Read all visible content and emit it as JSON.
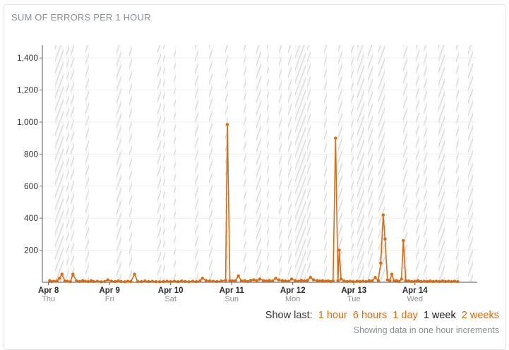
{
  "widget": {
    "title": "SUM OF ERRORS PER 1 HOUR"
  },
  "controls": {
    "show_last_label": "Show last:",
    "options": [
      {
        "label": "1 hour",
        "active": false
      },
      {
        "label": "6 hours",
        "active": false
      },
      {
        "label": "1 day",
        "active": false
      },
      {
        "label": "1 week",
        "active": true
      },
      {
        "label": "2 weeks",
        "active": false
      }
    ],
    "note": "Showing data in one hour increments"
  },
  "colors": {
    "series": "#d96b13",
    "accent": "#d96b13",
    "axis": "#555555"
  },
  "chart_data": {
    "type": "line",
    "title": "SUM OF ERRORS PER 1 HOUR",
    "xlabel": "",
    "ylabel": "",
    "ylim": [
      0,
      1480
    ],
    "y_ticks": [
      "200",
      "400",
      "600",
      "800",
      "1,000",
      "1,200",
      "1,400"
    ],
    "y_tick_values": [
      200,
      400,
      600,
      800,
      1000,
      1200,
      1400
    ],
    "x_ticks": [
      {
        "date": "Apr 8",
        "day": "Thu"
      },
      {
        "date": "Apr 9",
        "day": "Fri"
      },
      {
        "date": "Apr 10",
        "day": "Sat"
      },
      {
        "date": "Apr 11",
        "day": "Sun"
      },
      {
        "date": "Apr 12",
        "day": "Mon"
      },
      {
        "date": "Apr 13",
        "day": "Tue"
      },
      {
        "date": "Apr 14",
        "day": "Wed"
      }
    ],
    "x_range_days": [
      -0.1,
      7.02
    ],
    "grid": "vertical hatched bands",
    "legend": "none",
    "series": [
      {
        "points": [
          [
            0.02,
            10
          ],
          [
            0.05,
            5
          ],
          [
            0.09,
            6
          ],
          [
            0.14,
            8
          ],
          [
            0.18,
            25
          ],
          [
            0.22,
            50
          ],
          [
            0.27,
            8
          ],
          [
            0.31,
            6
          ],
          [
            0.36,
            4
          ],
          [
            0.4,
            50
          ],
          [
            0.46,
            8
          ],
          [
            0.51,
            5
          ],
          [
            0.56,
            10
          ],
          [
            0.6,
            6
          ],
          [
            0.65,
            5
          ],
          [
            0.7,
            10
          ],
          [
            0.74,
            5
          ],
          [
            0.8,
            6
          ],
          [
            0.86,
            3
          ],
          [
            0.92,
            5
          ],
          [
            0.97,
            15
          ],
          [
            1.03,
            6
          ],
          [
            1.09,
            5
          ],
          [
            1.14,
            8
          ],
          [
            1.19,
            5
          ],
          [
            1.25,
            3
          ],
          [
            1.3,
            6
          ],
          [
            1.35,
            5
          ],
          [
            1.41,
            50
          ],
          [
            1.46,
            5
          ],
          [
            1.52,
            4
          ],
          [
            1.58,
            8
          ],
          [
            1.64,
            5
          ],
          [
            1.7,
            6
          ],
          [
            1.76,
            4
          ],
          [
            1.82,
            3
          ],
          [
            1.88,
            5
          ],
          [
            1.94,
            6
          ],
          [
            2.0,
            5
          ],
          [
            2.06,
            6
          ],
          [
            2.12,
            4
          ],
          [
            2.18,
            8
          ],
          [
            2.24,
            5
          ],
          [
            2.3,
            3
          ],
          [
            2.36,
            6
          ],
          [
            2.42,
            4
          ],
          [
            2.48,
            8
          ],
          [
            2.52,
            25
          ],
          [
            2.58,
            10
          ],
          [
            2.64,
            8
          ],
          [
            2.7,
            6
          ],
          [
            2.76,
            5
          ],
          [
            2.83,
            8
          ],
          [
            2.9,
            12
          ],
          [
            2.93,
            985
          ],
          [
            2.97,
            10
          ],
          [
            3.01,
            8
          ],
          [
            3.06,
            10
          ],
          [
            3.11,
            40
          ],
          [
            3.16,
            8
          ],
          [
            3.21,
            10
          ],
          [
            3.26,
            5
          ],
          [
            3.31,
            12
          ],
          [
            3.36,
            15
          ],
          [
            3.41,
            10
          ],
          [
            3.46,
            20
          ],
          [
            3.52,
            10
          ],
          [
            3.57,
            8
          ],
          [
            3.62,
            10
          ],
          [
            3.67,
            8
          ],
          [
            3.72,
            25
          ],
          [
            3.77,
            15
          ],
          [
            3.83,
            10
          ],
          [
            3.88,
            8
          ],
          [
            3.93,
            6
          ],
          [
            3.98,
            20
          ],
          [
            4.04,
            10
          ],
          [
            4.09,
            6
          ],
          [
            4.14,
            12
          ],
          [
            4.19,
            8
          ],
          [
            4.24,
            12
          ],
          [
            4.29,
            30
          ],
          [
            4.34,
            15
          ],
          [
            4.4,
            10
          ],
          [
            4.44,
            8
          ],
          [
            4.49,
            10
          ],
          [
            4.54,
            6
          ],
          [
            4.58,
            8
          ],
          [
            4.62,
            5
          ],
          [
            4.66,
            8
          ],
          [
            4.7,
            900
          ],
          [
            4.74,
            10
          ],
          [
            4.76,
            200
          ],
          [
            4.79,
            20
          ],
          [
            4.84,
            8
          ],
          [
            4.89,
            5
          ],
          [
            4.94,
            6
          ],
          [
            4.99,
            5
          ],
          [
            5.05,
            6
          ],
          [
            5.1,
            5
          ],
          [
            5.15,
            6
          ],
          [
            5.2,
            5
          ],
          [
            5.25,
            10
          ],
          [
            5.3,
            8
          ],
          [
            5.35,
            30
          ],
          [
            5.4,
            10
          ],
          [
            5.44,
            120
          ],
          [
            5.48,
            420
          ],
          [
            5.51,
            270
          ],
          [
            5.55,
            15
          ],
          [
            5.59,
            10
          ],
          [
            5.62,
            50
          ],
          [
            5.66,
            8
          ],
          [
            5.7,
            10
          ],
          [
            5.74,
            5
          ],
          [
            5.78,
            20
          ],
          [
            5.81,
            260
          ],
          [
            5.85,
            10
          ],
          [
            5.9,
            8
          ],
          [
            5.95,
            5
          ],
          [
            6.0,
            6
          ],
          [
            6.05,
            10
          ],
          [
            6.1,
            5
          ],
          [
            6.15,
            6
          ],
          [
            6.2,
            5
          ],
          [
            6.25,
            8
          ],
          [
            6.3,
            5
          ],
          [
            6.35,
            6
          ],
          [
            6.4,
            5
          ],
          [
            6.45,
            8
          ],
          [
            6.5,
            5
          ],
          [
            6.55,
            6
          ],
          [
            6.6,
            5
          ],
          [
            6.65,
            6
          ],
          [
            6.7,
            4
          ]
        ]
      }
    ]
  }
}
